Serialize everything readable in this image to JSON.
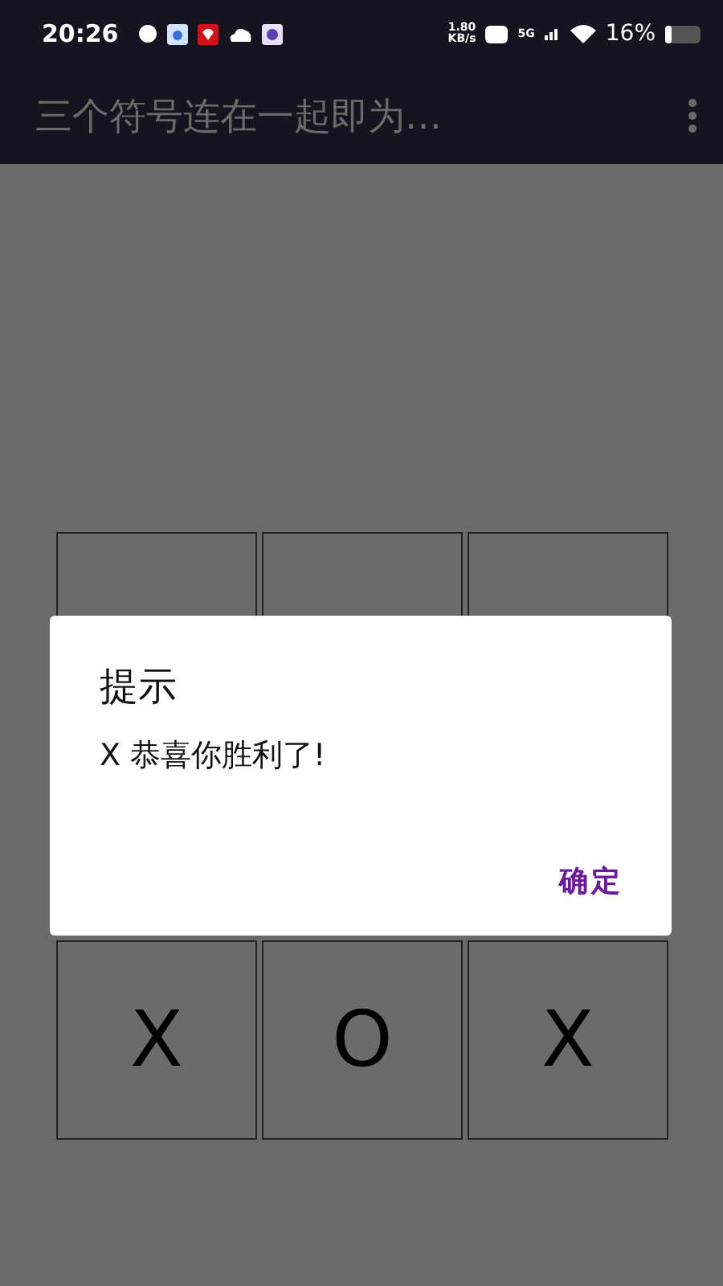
{
  "status_bar": {
    "time": "20:26",
    "speed": "1.80\nKB/s",
    "network": "5G",
    "battery": "16%"
  },
  "app_bar": {
    "title": "三个符号连在一起即为…"
  },
  "board": {
    "bottom_row": [
      "X",
      "O",
      "X"
    ]
  },
  "dialog": {
    "title": "提示",
    "message": "X 恭喜你胜利了!",
    "button": "确定"
  }
}
